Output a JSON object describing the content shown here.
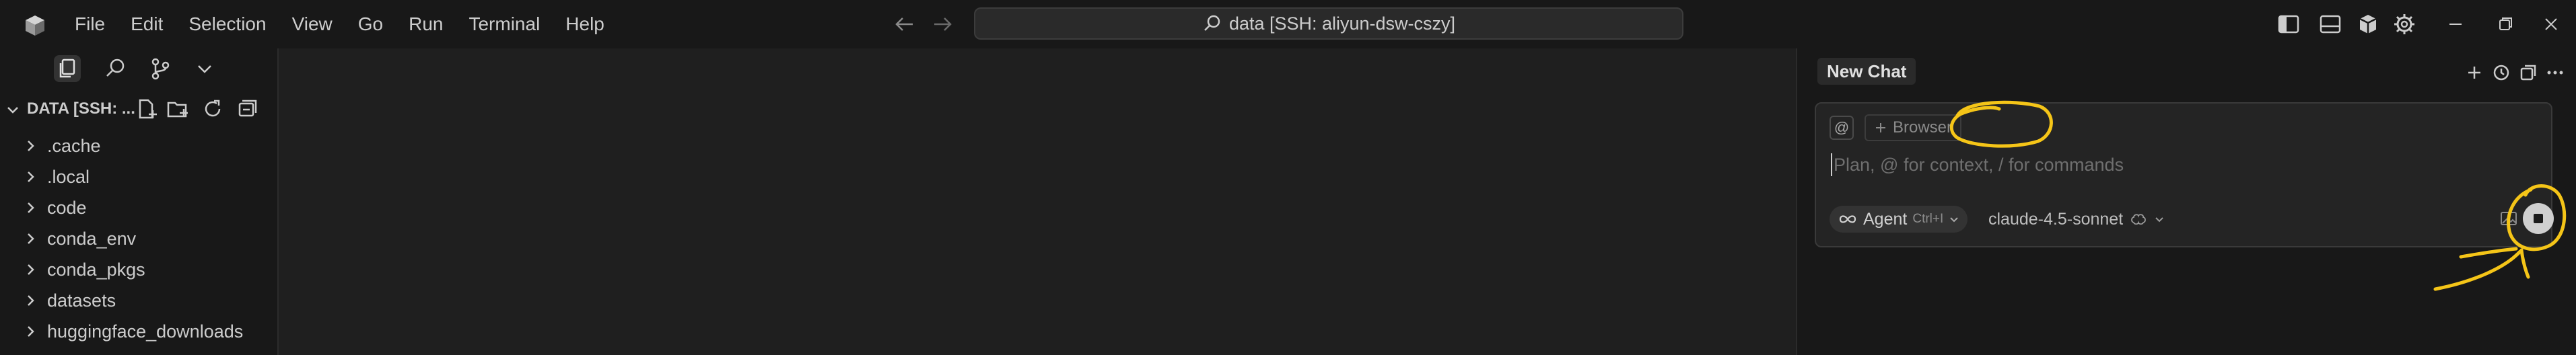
{
  "menu": [
    "File",
    "Edit",
    "Selection",
    "View",
    "Go",
    "Run",
    "Terminal",
    "Help"
  ],
  "search": {
    "text": "data [SSH: aliyun-dsw-cszy]"
  },
  "explorer": {
    "title": "DATA [SSH: ...",
    "items": [
      ".cache",
      ".local",
      "code",
      "conda_env",
      "conda_pkgs",
      "datasets",
      "huggingface_downloads"
    ]
  },
  "chat": {
    "tab_label": "New Chat",
    "at_symbol": "@",
    "browser_label": "Browser",
    "input_placeholder": "Plan, @ for context, / for commands",
    "mode_label": "Agent",
    "mode_shortcut": "Ctrl+I",
    "model_label": "claude-4.5-sonnet"
  },
  "icons": {
    "titlebar": [
      "toggle-primary-sidebar-icon",
      "toggle-panel-icon",
      "toggle-secondary-sidebar-icon",
      "settings-gear-icon"
    ],
    "window": [
      "minimize-icon",
      "restore-icon",
      "close-icon"
    ]
  },
  "colors": {
    "annotation": "#f5c518",
    "accent": "#cfcfcf"
  }
}
